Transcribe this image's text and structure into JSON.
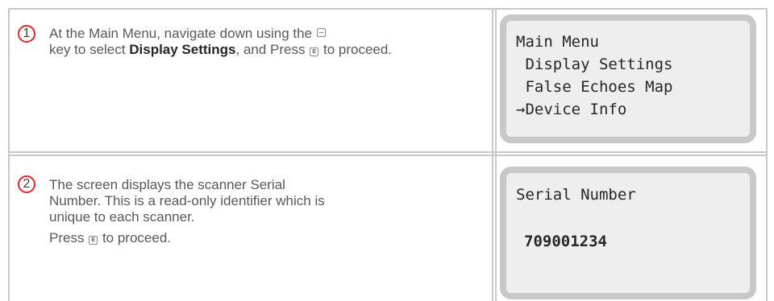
{
  "steps": [
    {
      "number": "1",
      "text_part1": "At the Main Menu, navigate down using the",
      "key_down_icon": "down-key-icon",
      "text_part2": "key to select",
      "bold": "Display Settings",
      "text_part3": ", and Press",
      "key_enter_label": "E",
      "text_part4": "to proceed.",
      "screen": {
        "lines": [
          "Main Menu",
          " Display Settings",
          " False Echoes Map",
          "→Device Info"
        ]
      }
    },
    {
      "number": "2",
      "para1": "The screen displays the scanner Serial Number. This is a read-only identifier which is unique to each scanner.",
      "para2_part1": "Press",
      "key_enter_label": "E",
      "para2_part2": "to proceed.",
      "screen": {
        "title": "Serial Number",
        "value": "709001234"
      }
    }
  ],
  "colors": {
    "badge_border": "#e0282a",
    "grid": "#c8c8c8",
    "lcd_bg": "#eeeeee"
  }
}
